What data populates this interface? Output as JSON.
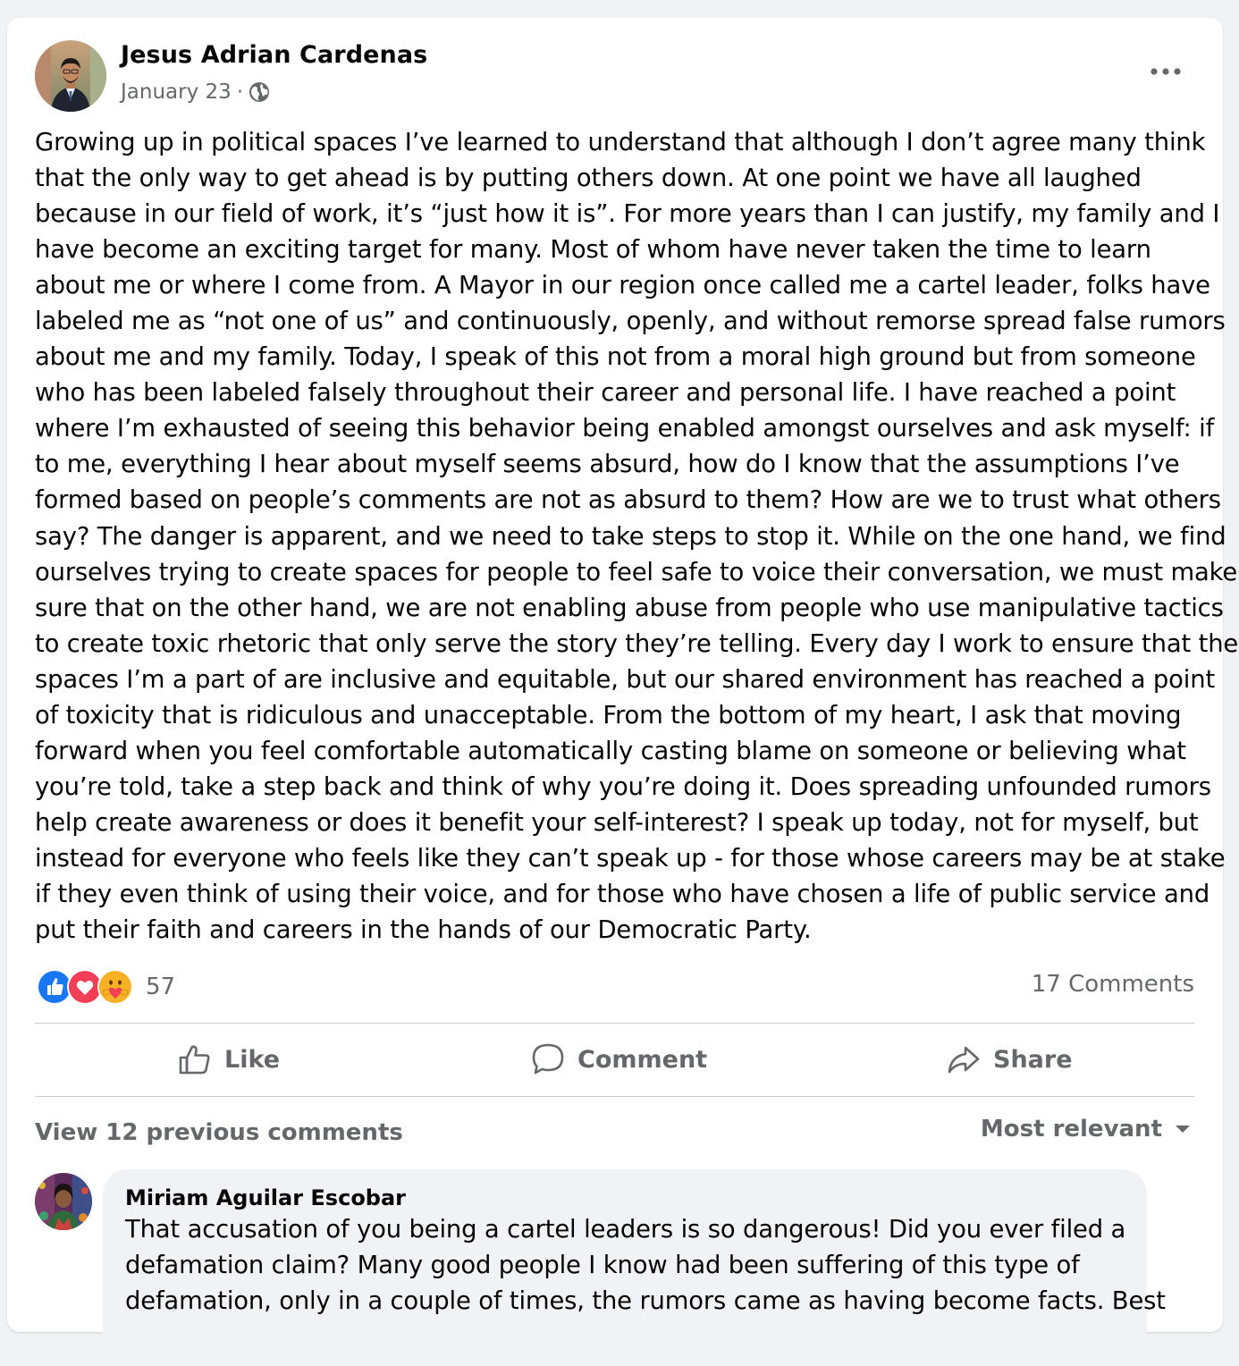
{
  "post": {
    "author": "Jesus Adrian Cardenas",
    "date": "January 23",
    "separator": "·",
    "privacy_icon": "globe-icon",
    "text_lines": [
      "Growing up in political spaces I’ve learned to understand that although I don’t agree many think",
      "that the only way to get ahead is by putting others down. At one point we have all laughed",
      "because in our field of work, it’s “just how it is”. For more years than I can justify, my family and I",
      "have become an exciting target for many. Most of whom have never taken the time to learn",
      "about me or where I come from. A Mayor in our region once called me a cartel leader, folks have",
      "labeled me as “not one of us” and continuously, openly, and without remorse spread false rumors",
      "about me and my family. Today, I speak of this not from a moral high ground but from someone",
      "who has been labeled falsely throughout their career and personal life. I have reached a point",
      "where I’m exhausted of seeing this behavior being enabled amongst ourselves and ask myself: if",
      "to me, everything I hear about myself seems absurd, how do I know that the assumptions I’ve",
      "formed based on people’s comments are not as absurd to them? How are we to trust what others",
      "say? The danger is apparent, and we need to take steps to stop it. While on the one hand, we find",
      "ourselves trying to create spaces for people to feel safe to voice their conversation, we must make",
      "sure that on the other hand, we are not enabling abuse from people who use manipulative tactics",
      "to create toxic rhetoric that only serve the story they’re telling. Every day I work to ensure that the",
      "spaces I’m a part of are inclusive and equitable, but our shared environment has reached a point",
      "of toxicity that is ridiculous and unacceptable. From the bottom of my heart, I ask that moving",
      "forward when you feel comfortable automatically casting blame on someone or believing what",
      "you’re told, take a step back and think of why you’re doing it. Does spreading unfounded rumors",
      "help create awareness or does it benefit your self-interest? I speak up today, not for myself, but",
      "instead for everyone who feels like they can’t speak up - for those whose careers may be at stake",
      "if they even think of using their voice, and for those who have chosen a life of public service and",
      "put their faith and careers in the hands of our Democratic Party."
    ],
    "reactions": {
      "icons": [
        "like-reaction-icon",
        "love-reaction-icon",
        "care-reaction-icon"
      ],
      "count": "57"
    },
    "comments_count": "17 Comments"
  },
  "actions": {
    "like": "Like",
    "comment": "Comment",
    "share": "Share"
  },
  "comments_section": {
    "view_previous": "View 12 previous comments",
    "sort_label": "Most relevant"
  },
  "comment": {
    "author": "Miriam Aguilar Escobar",
    "text_lines": [
      "That accusation of you being a cartel leaders is so dangerous! Did you ever filed a",
      "defamation claim? Many good people I know had been suffering of this type of",
      "defamation, only in a couple of times, the rumors came as having become facts. Best"
    ]
  },
  "colors": {
    "primary_text": "#050505",
    "secondary_text": "#65676b",
    "like_blue": "#1877f2",
    "love_red": "#f33e58",
    "care_yellow": "#f7b125",
    "background": "#f0f2f5",
    "card": "#ffffff",
    "divider": "#ced0d4"
  }
}
